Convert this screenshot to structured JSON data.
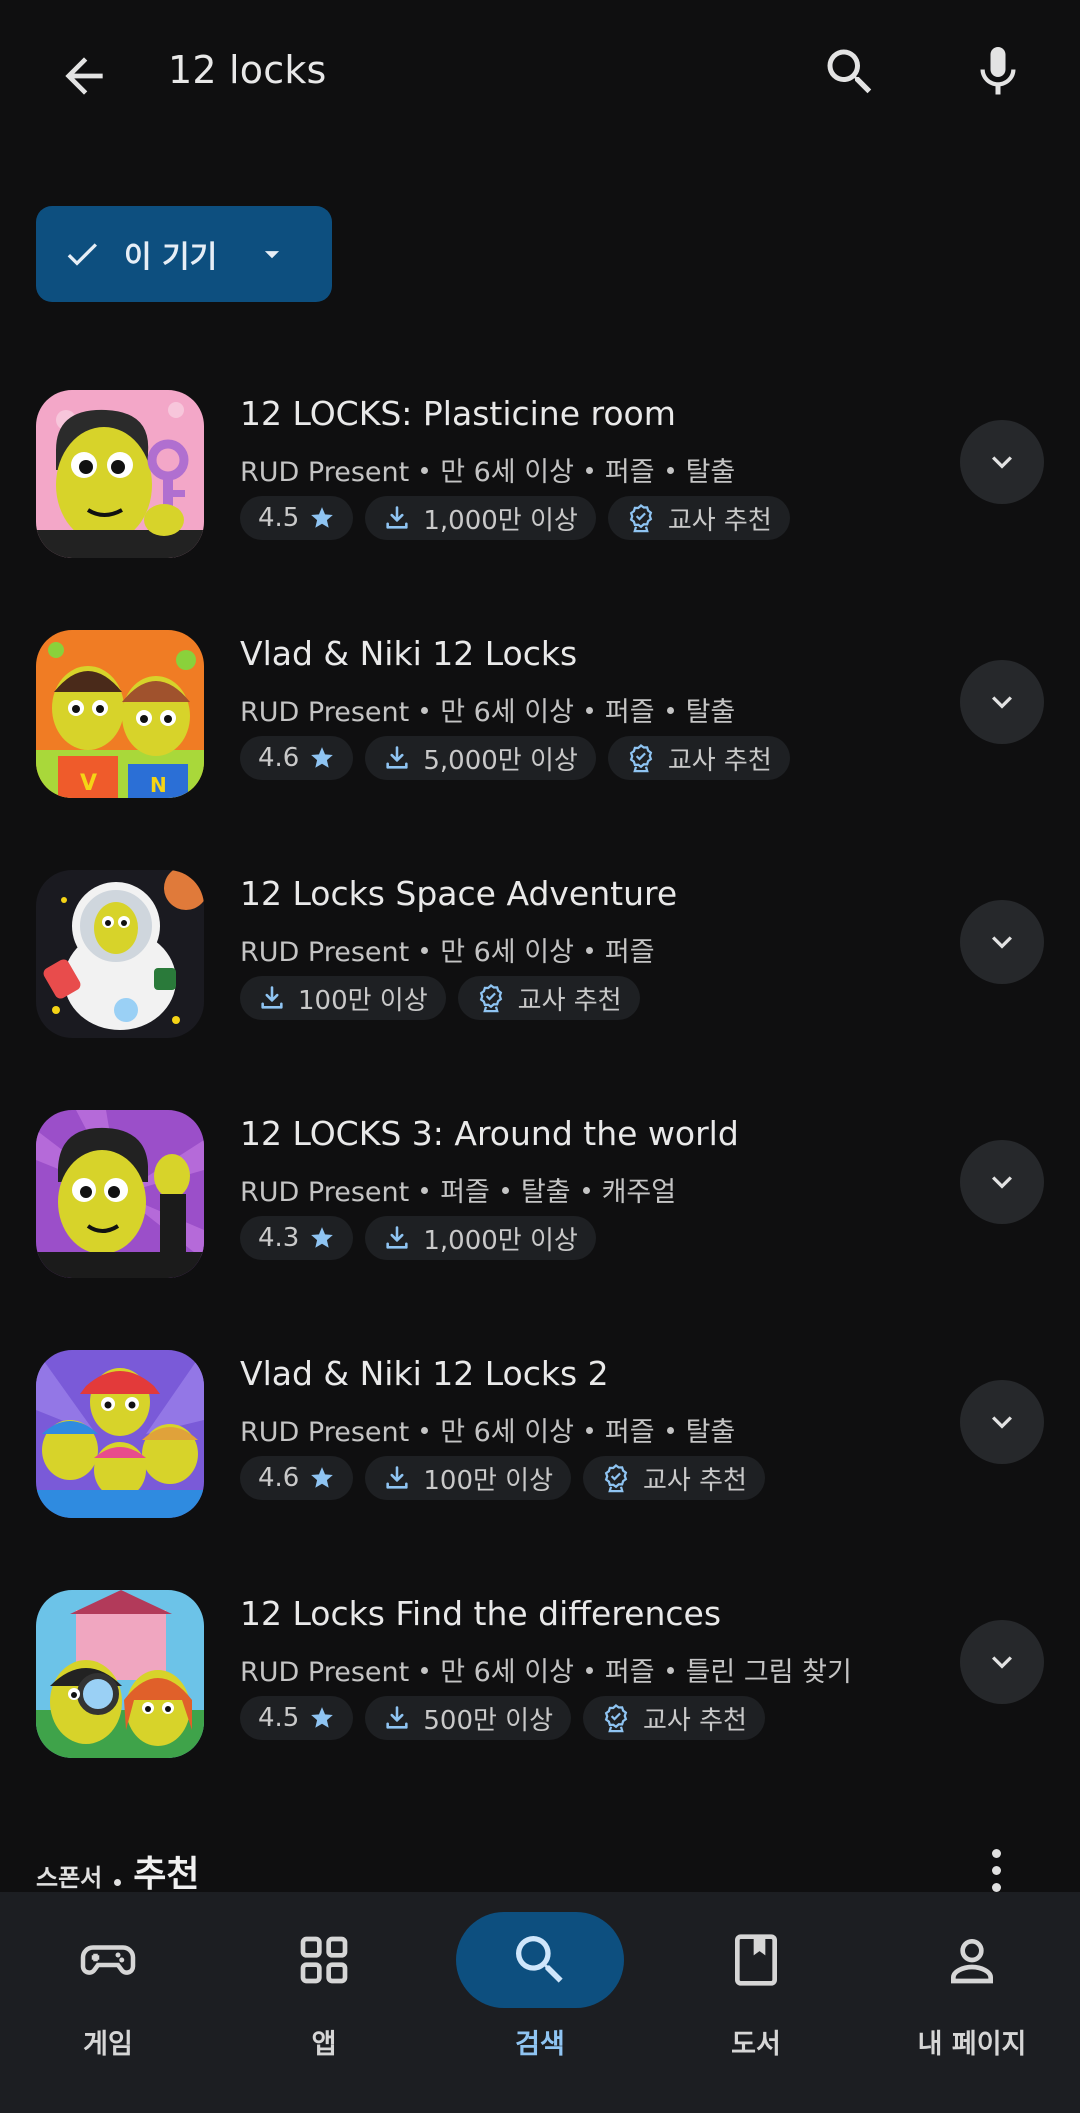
{
  "search": {
    "query": "12 locks"
  },
  "filter": {
    "label": "이 기기"
  },
  "apps": [
    {
      "title": "12 LOCKS: Plasticine room",
      "meta": [
        "RUD Present",
        "만 6세 이상",
        "퍼즐",
        "탈출"
      ],
      "rating": "4.5",
      "downloads": "1,000만 이상",
      "badge": "교사 추천"
    },
    {
      "title": "Vlad & Niki 12 Locks",
      "meta": [
        "RUD Present",
        "만 6세 이상",
        "퍼즐",
        "탈출"
      ],
      "rating": "4.6",
      "downloads": "5,000만 이상",
      "badge": "교사 추천"
    },
    {
      "title": "12 Locks Space Adventure",
      "meta": [
        "RUD Present",
        "만 6세 이상",
        "퍼즐"
      ],
      "rating": null,
      "downloads": "100만 이상",
      "badge": "교사 추천"
    },
    {
      "title": "12 LOCKS 3: Around the world",
      "meta": [
        "RUD Present",
        "퍼즐",
        "탈출",
        "캐주얼"
      ],
      "rating": "4.3",
      "downloads": "1,000만 이상",
      "badge": null
    },
    {
      "title": "Vlad & Niki 12 Locks 2",
      "meta": [
        "RUD Present",
        "만 6세 이상",
        "퍼즐",
        "탈출"
      ],
      "rating": "4.6",
      "downloads": "100만 이상",
      "badge": "교사 추천"
    },
    {
      "title": "12 Locks Find the differences",
      "meta": [
        "RUD Present",
        "만 6세 이상",
        "퍼즐",
        "틀린 그림 찾기"
      ],
      "rating": "4.5",
      "downloads": "500만 이상",
      "badge": "교사 추천"
    }
  ],
  "sponsored": {
    "label": "스폰서",
    "title": "추천"
  },
  "nav": [
    {
      "label": "게임",
      "icon": "gamepad-icon",
      "active": false
    },
    {
      "label": "앱",
      "icon": "apps-grid-icon",
      "active": false
    },
    {
      "label": "검색",
      "icon": "search-icon",
      "active": true
    },
    {
      "label": "도서",
      "icon": "book-icon",
      "active": false
    },
    {
      "label": "내 페이지",
      "icon": "person-icon",
      "active": false
    }
  ],
  "colors": {
    "background": "#0f0f10",
    "accent": "#0d4f7f",
    "accent_text": "#8fc4f2",
    "pill": "#1e2023",
    "star": "#8fc4f2"
  }
}
